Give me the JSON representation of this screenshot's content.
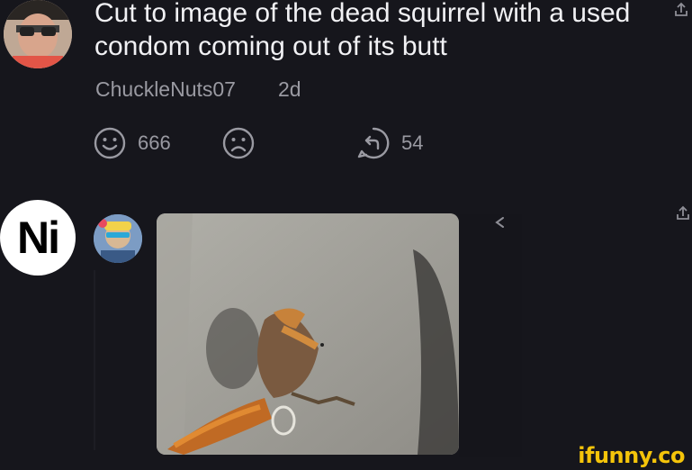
{
  "comment": {
    "text": "Cut to image of the dead squirrel with a used condom coming out of its butt",
    "username": "ChuckleNuts07",
    "time": "2d",
    "likes": "666",
    "replies": "54"
  },
  "reply": {
    "badge_text": "Ni"
  },
  "watermark": "ifunny.co",
  "colors": {
    "background": "#16161c",
    "muted_text": "#9a9aa2",
    "watermark": "#f4c40a"
  }
}
